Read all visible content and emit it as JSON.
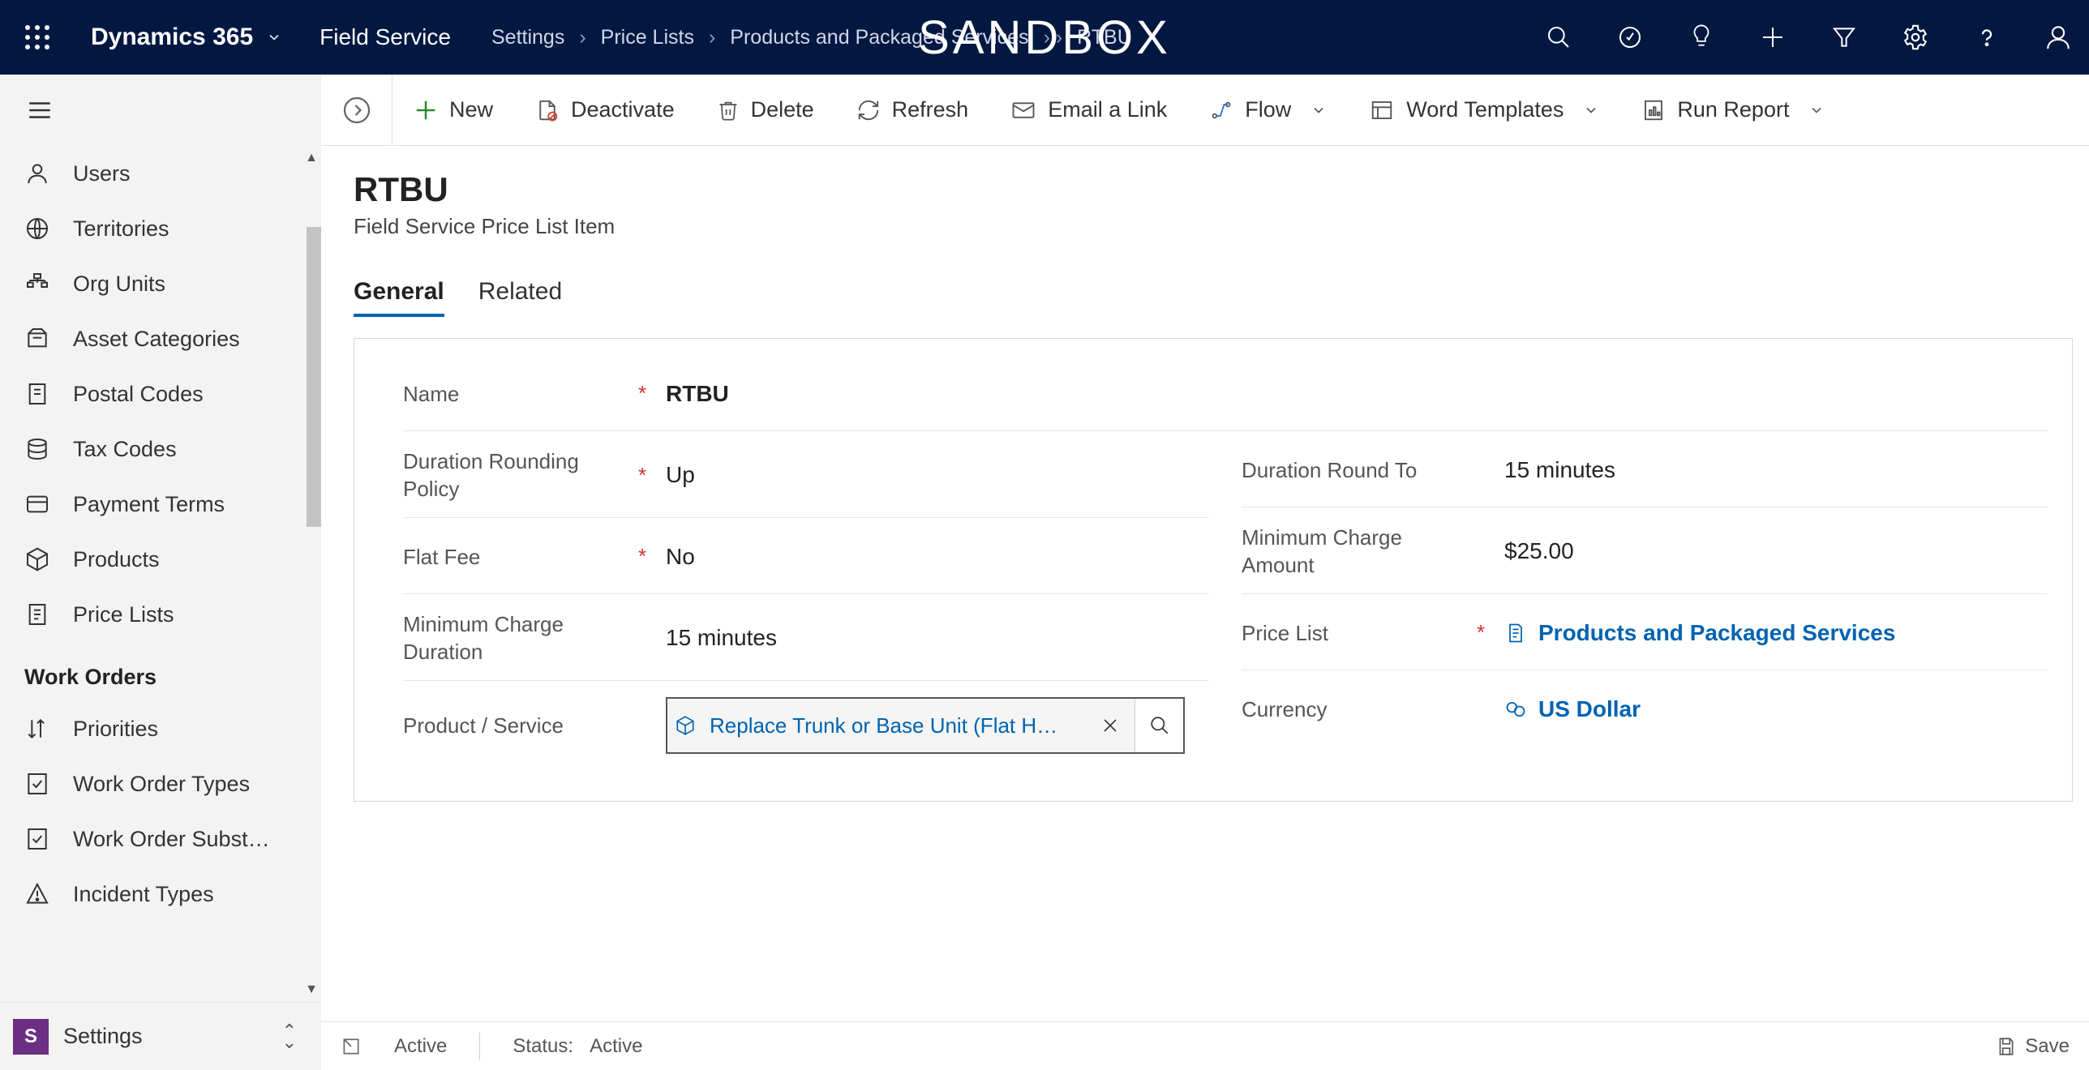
{
  "topbar": {
    "app_name": "Dynamics 365",
    "module": "Field Service",
    "crumbs": [
      "Settings",
      "Price Lists",
      "Products and Packaged Services",
      "RTBU"
    ],
    "sandbox": "SANDBOX"
  },
  "commands": {
    "new": "New",
    "deactivate": "Deactivate",
    "delete": "Delete",
    "refresh": "Refresh",
    "email": "Email a Link",
    "flow": "Flow",
    "word": "Word Templates",
    "report": "Run Report"
  },
  "sidenav": {
    "items1": [
      "Users",
      "Territories",
      "Org Units",
      "Asset Categories",
      "Postal Codes",
      "Tax Codes",
      "Payment Terms",
      "Products",
      "Price Lists"
    ],
    "section2": "Work Orders",
    "items2": [
      "Priorities",
      "Work Order Types",
      "Work Order Subst…",
      "Incident Types"
    ],
    "area_letter": "S",
    "area_name": "Settings"
  },
  "record": {
    "title": "RTBU",
    "subtitle": "Field Service Price List Item",
    "tabs": {
      "general": "General",
      "related": "Related"
    },
    "fields": {
      "name_label": "Name",
      "name_value": "RTBU",
      "dur_policy_label": "Duration Rounding Policy",
      "dur_policy_value": "Up",
      "dur_round_label": "Duration Round To",
      "dur_round_value": "15 minutes",
      "flatfee_label": "Flat Fee",
      "flatfee_value": "No",
      "mincharge_amt_label": "Minimum Charge Amount",
      "mincharge_amt_value": "$25.00",
      "mincharge_dur_label": "Minimum Charge Duration",
      "mincharge_dur_value": "15 minutes",
      "pricelist_label": "Price List",
      "pricelist_value": "Products and Packaged Services",
      "prodservice_label": "Product / Service",
      "prodservice_value": "Replace Trunk or Base Unit (Flat H…",
      "currency_label": "Currency",
      "currency_value": "US Dollar"
    }
  },
  "statusbar": {
    "state": "Active",
    "status_label": "Status:",
    "status_value": "Active",
    "save": "Save"
  }
}
